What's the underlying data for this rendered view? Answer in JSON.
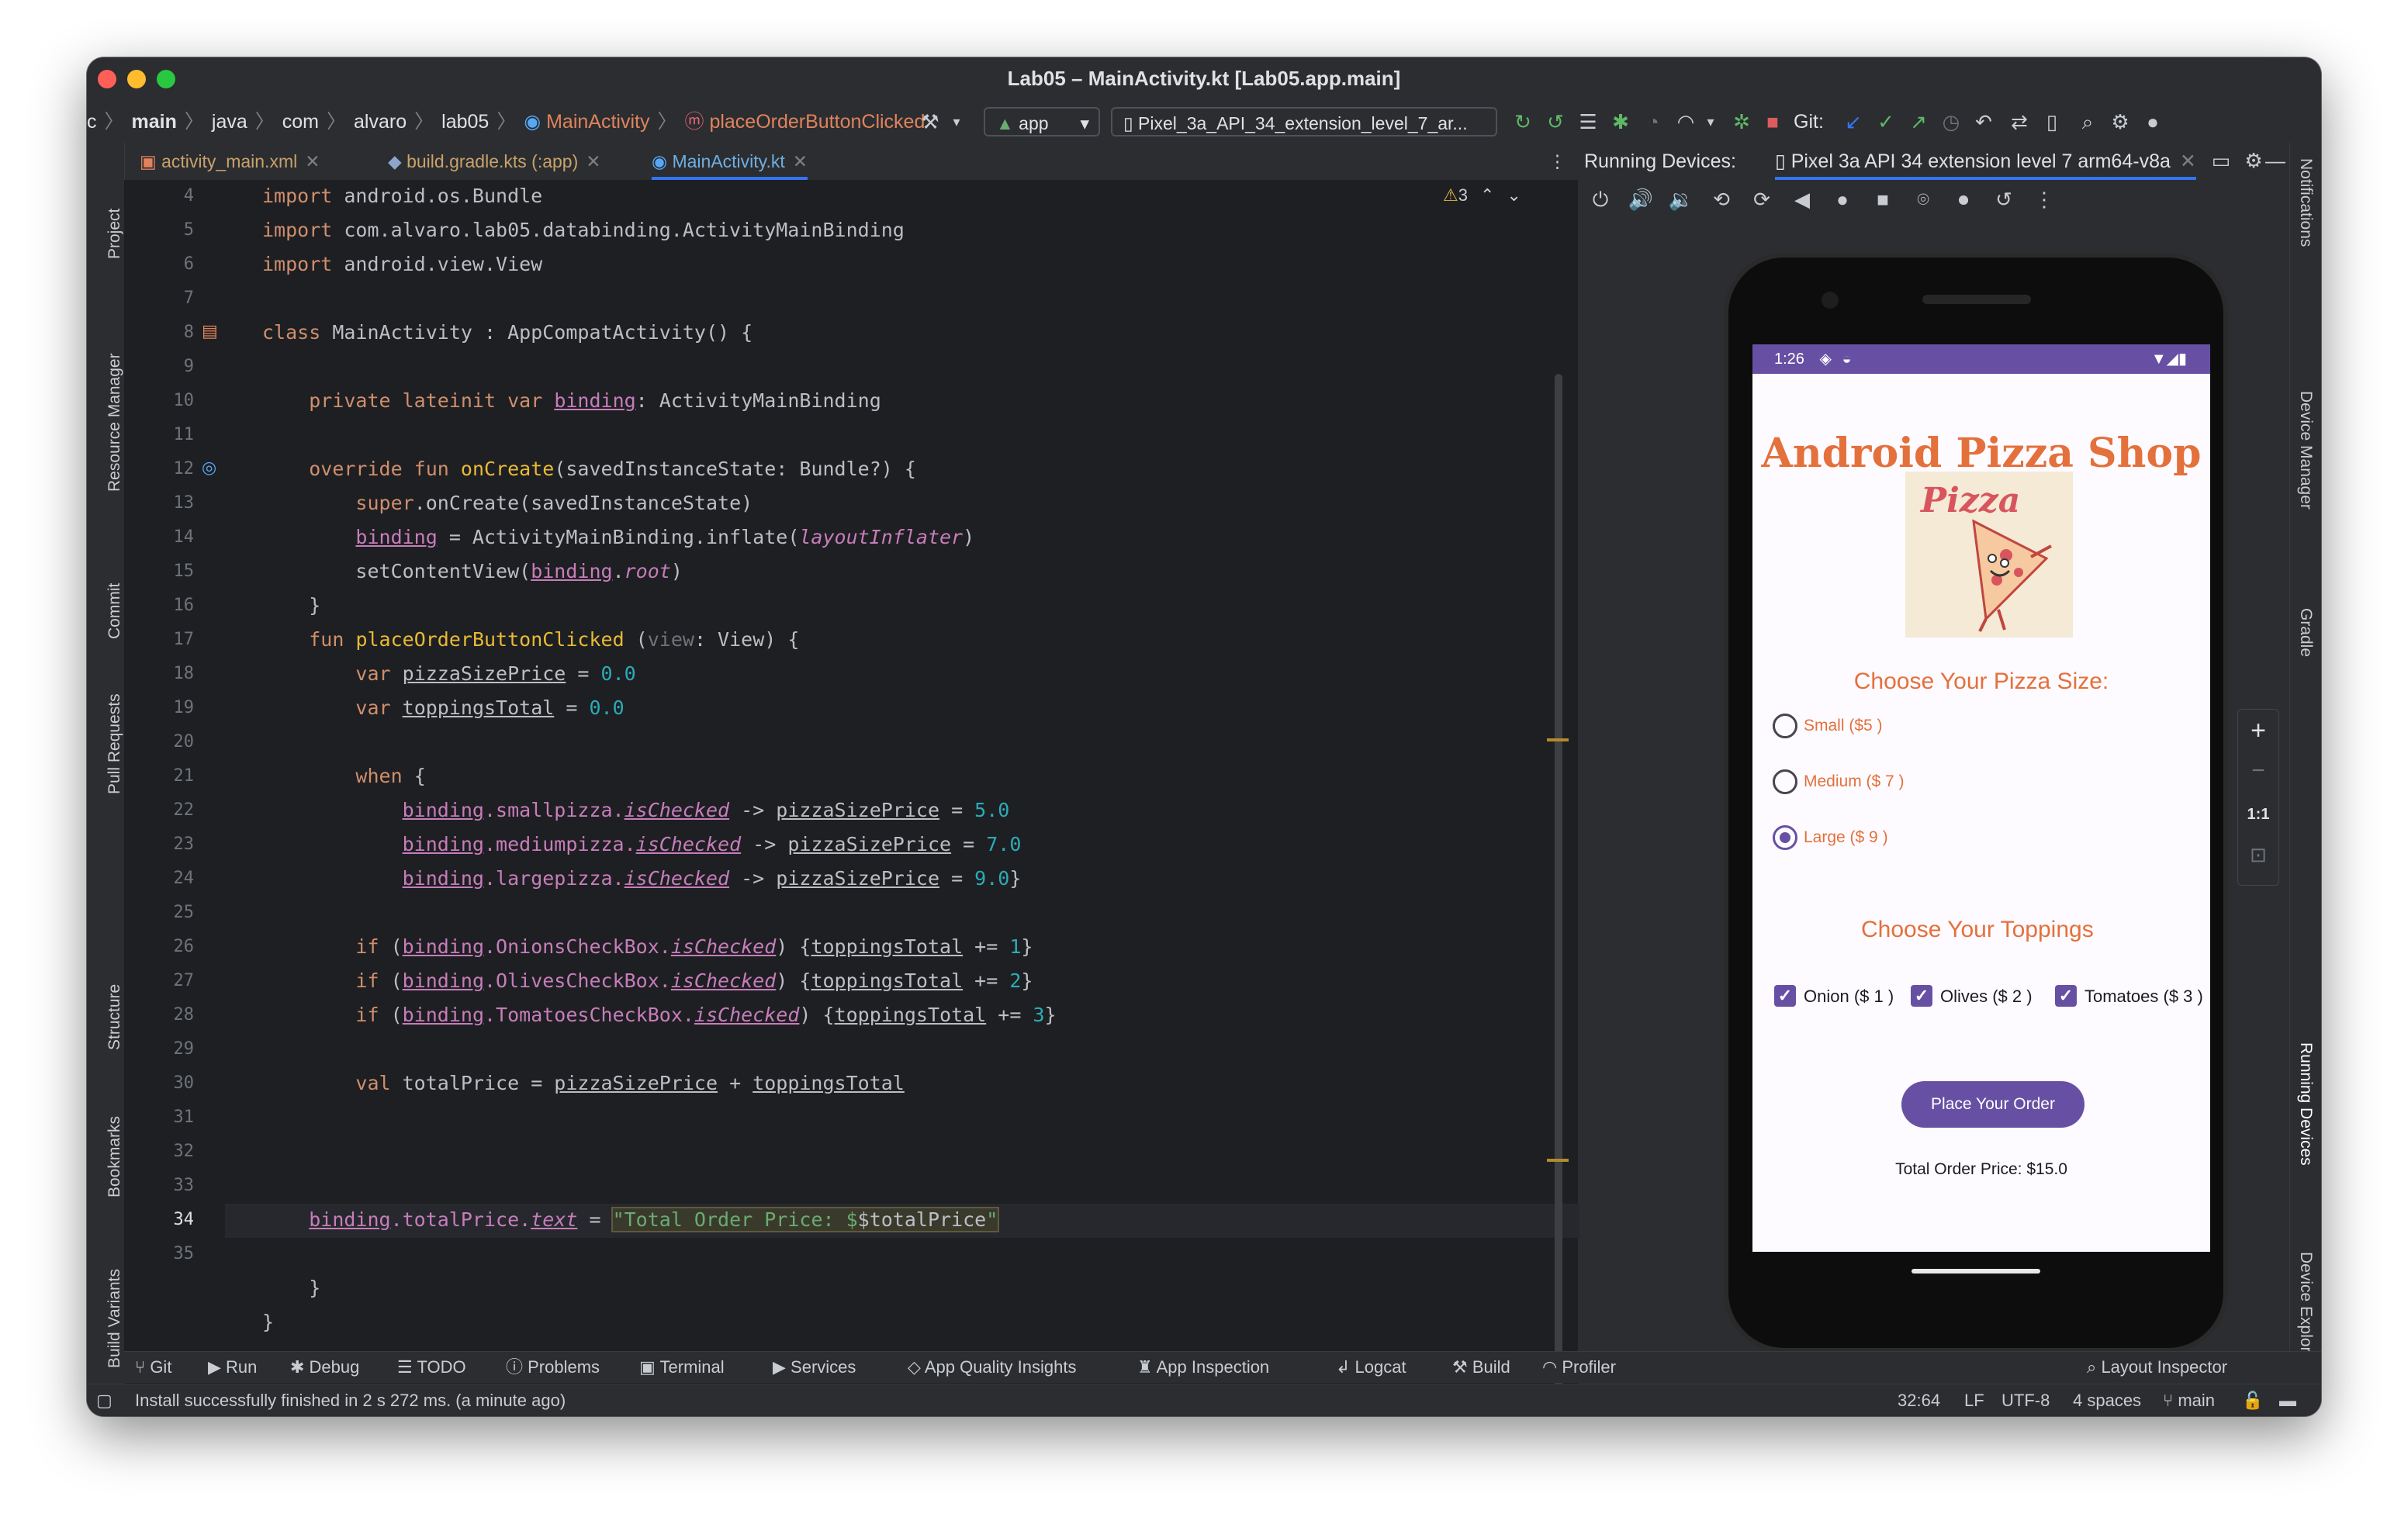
{
  "window": {
    "title": "Lab05 – MainActivity.kt [Lab05.app.main]"
  },
  "breadcrumb": [
    "c",
    "main",
    "java",
    "com",
    "alvaro",
    "lab05",
    "MainActivity",
    "placeOrderButtonClicked"
  ],
  "toolbar": {
    "config_label": "app",
    "device_label": "Pixel_3a_API_34_extension_level_7_ar...",
    "git_label": "Git:"
  },
  "tabs": [
    {
      "label": "activity_main.xml"
    },
    {
      "label": "build.gradle.kts (:app)"
    },
    {
      "label": "MainActivity.kt"
    }
  ],
  "left_tools": [
    "Project",
    "Resource Manager",
    "Commit",
    "Pull Requests",
    "Structure",
    "Bookmarks",
    "Build Variants"
  ],
  "right_tools": [
    "Notifications",
    "Device Manager",
    "Gradle",
    "Running Devices",
    "Device Explorer"
  ],
  "editor": {
    "warnings": "3",
    "line_numbers": [
      "4",
      "5",
      "6",
      "7",
      "8",
      "9",
      "10",
      "11",
      "12",
      "13",
      "14",
      "15",
      "16",
      "17",
      "18",
      "19",
      "20",
      "21",
      "22",
      "23",
      "24",
      "25",
      "26",
      "27",
      "28",
      "29",
      "30",
      "31",
      "32",
      "33",
      "34",
      "35"
    ],
    "code": {
      "l4_kw": "import",
      "l4_rest": " android.os.Bundle",
      "l5_kw": "import",
      "l5_rest": " com.alvaro.lab05.databinding.ActivityMainBinding",
      "l6_kw": "import",
      "l6_rest": " android.view.View",
      "l8_kw": "class",
      "l8_rest": " MainActivity : AppCompatActivity() {",
      "l10_kw": "private lateinit var",
      "l10_prop": "binding",
      "l10_rest": ": ActivityMainBinding",
      "l12_kw": "override fun",
      "l12_fn": "onCreate",
      "l12_rest": "(savedInstanceState: Bundle?) {",
      "l13_kw": "super",
      "l13_rest": ".onCreate(savedInstanceState)",
      "l14_prop": "binding",
      "l14_rest": " = ActivityMainBinding.inflate(",
      "l14_it": "layoutInflater",
      "l14_end": ")",
      "l15_a": "setContentView(",
      "l15_prop": "binding",
      "l15_dot": ".",
      "l15_it": "root",
      "l15_end": ")",
      "l16": "}",
      "l17_kw": "fun",
      "l17_fn": "placeOrderButtonClicked",
      "l17_a": " (",
      "l17_gr": "view",
      "l17_rest": ": View) {",
      "l18_kw": "var",
      "l18_var": "pizzaSizePrice",
      "l18_eq": " = ",
      "l18_num": "0.0",
      "l19_kw": "var",
      "l19_var": "toppingsTotal",
      "l19_eq": " = ",
      "l19_num": "0.0",
      "l21_kw": "when",
      "l21_rest": " {",
      "l22_prop": "binding",
      "l22_mid": ".smallpizza.",
      "l22_it": "isChecked",
      "l22_arrow": " -> ",
      "l22_var": "pizzaSizePrice",
      "l22_eq": " = ",
      "l22_num": "5.0",
      "l23_prop": "binding",
      "l23_mid": ".mediumpizza.",
      "l23_it": "isChecked",
      "l23_arrow": " -> ",
      "l23_var": "pizzaSizePrice",
      "l23_eq": " = ",
      "l23_num": "7.0",
      "l24_prop": "binding",
      "l24_mid": ".largepizza.",
      "l24_it": "isChecked",
      "l24_arrow": " -> ",
      "l24_var": "pizzaSizePrice",
      "l24_eq": " = ",
      "l24_num": "9.0",
      "l24_end": "}",
      "l26_kw": "if",
      "l26_a": " (",
      "l26_prop": "binding",
      "l26_mid": ".OnionsCheckBox.",
      "l26_it": "isChecked",
      "l26_b": ") {",
      "l26_var": "toppingsTotal",
      "l26_op": " += ",
      "l26_num": "1",
      "l26_end": "}",
      "l27_kw": "if",
      "l27_a": " (",
      "l27_prop": "binding",
      "l27_mid": ".OlivesCheckBox.",
      "l27_it": "isChecked",
      "l27_b": ") {",
      "l27_var": "toppingsTotal",
      "l27_op": " += ",
      "l27_num": "2",
      "l27_end": "}",
      "l28_kw": "if",
      "l28_a": " (",
      "l28_prop": "binding",
      "l28_mid": ".TomatoesCheckBox.",
      "l28_it": "isChecked",
      "l28_b": ") {",
      "l28_var": "toppingsTotal",
      "l28_op": " += ",
      "l28_num": "3",
      "l28_end": "}",
      "l30_kw": "val",
      "l30_a": " totalPrice = ",
      "l30_v1": "pizzaSizePrice",
      "l30_plus": " + ",
      "l30_v2": "toppingsTotal",
      "l32_prop": "binding",
      "l32_mid": ".totalPrice.",
      "l32_it": "text",
      "l32_eq": " = ",
      "l32_str": "\"Total Order Price: $",
      "l32_var": "$totalPrice",
      "l32_q": "\"",
      "l34": "}",
      "l35": "}"
    }
  },
  "running_devices": {
    "label": "Running Devices:",
    "device_tab": "Pixel 3a API 34 extension level 7 arm64-v8a"
  },
  "app": {
    "status_time": "1:26",
    "title": "Android Pizza Shop",
    "logo_text": "Pizza",
    "size_header": "Choose Your Pizza Size:",
    "sizes": [
      {
        "label": "Small ($5 )",
        "selected": false
      },
      {
        "label": "Medium ($ 7 )",
        "selected": false
      },
      {
        "label": "Large ($ 9 )",
        "selected": true
      }
    ],
    "toppings_header": "Choose Your Toppings",
    "toppings": [
      {
        "label": "Onion ($ 1 )",
        "checked": true
      },
      {
        "label": "Olives ($ 2 )",
        "checked": true
      },
      {
        "label": "Tomatoes ($ 3 )",
        "checked": true
      }
    ],
    "order_button": "Place Your Order",
    "total_text": "Total Order Price: $15.0",
    "accent_color": "#6750a4",
    "text_accent": "#e4703c"
  },
  "zoom": {
    "plus": "+",
    "minus": "−",
    "ratio": "1:1"
  },
  "bottom_tools": [
    "Git",
    "Run",
    "Debug",
    "TODO",
    "Problems",
    "Terminal",
    "Services",
    "App Quality Insights",
    "App Inspection",
    "Logcat",
    "Build",
    "Profiler",
    "Layout Inspector"
  ],
  "status": {
    "message": "Install successfully finished in 2 s 272 ms. (a minute ago)",
    "position": "32:64",
    "line_ending": "LF",
    "encoding": "UTF-8",
    "indent": "4 spaces",
    "branch": "main"
  }
}
